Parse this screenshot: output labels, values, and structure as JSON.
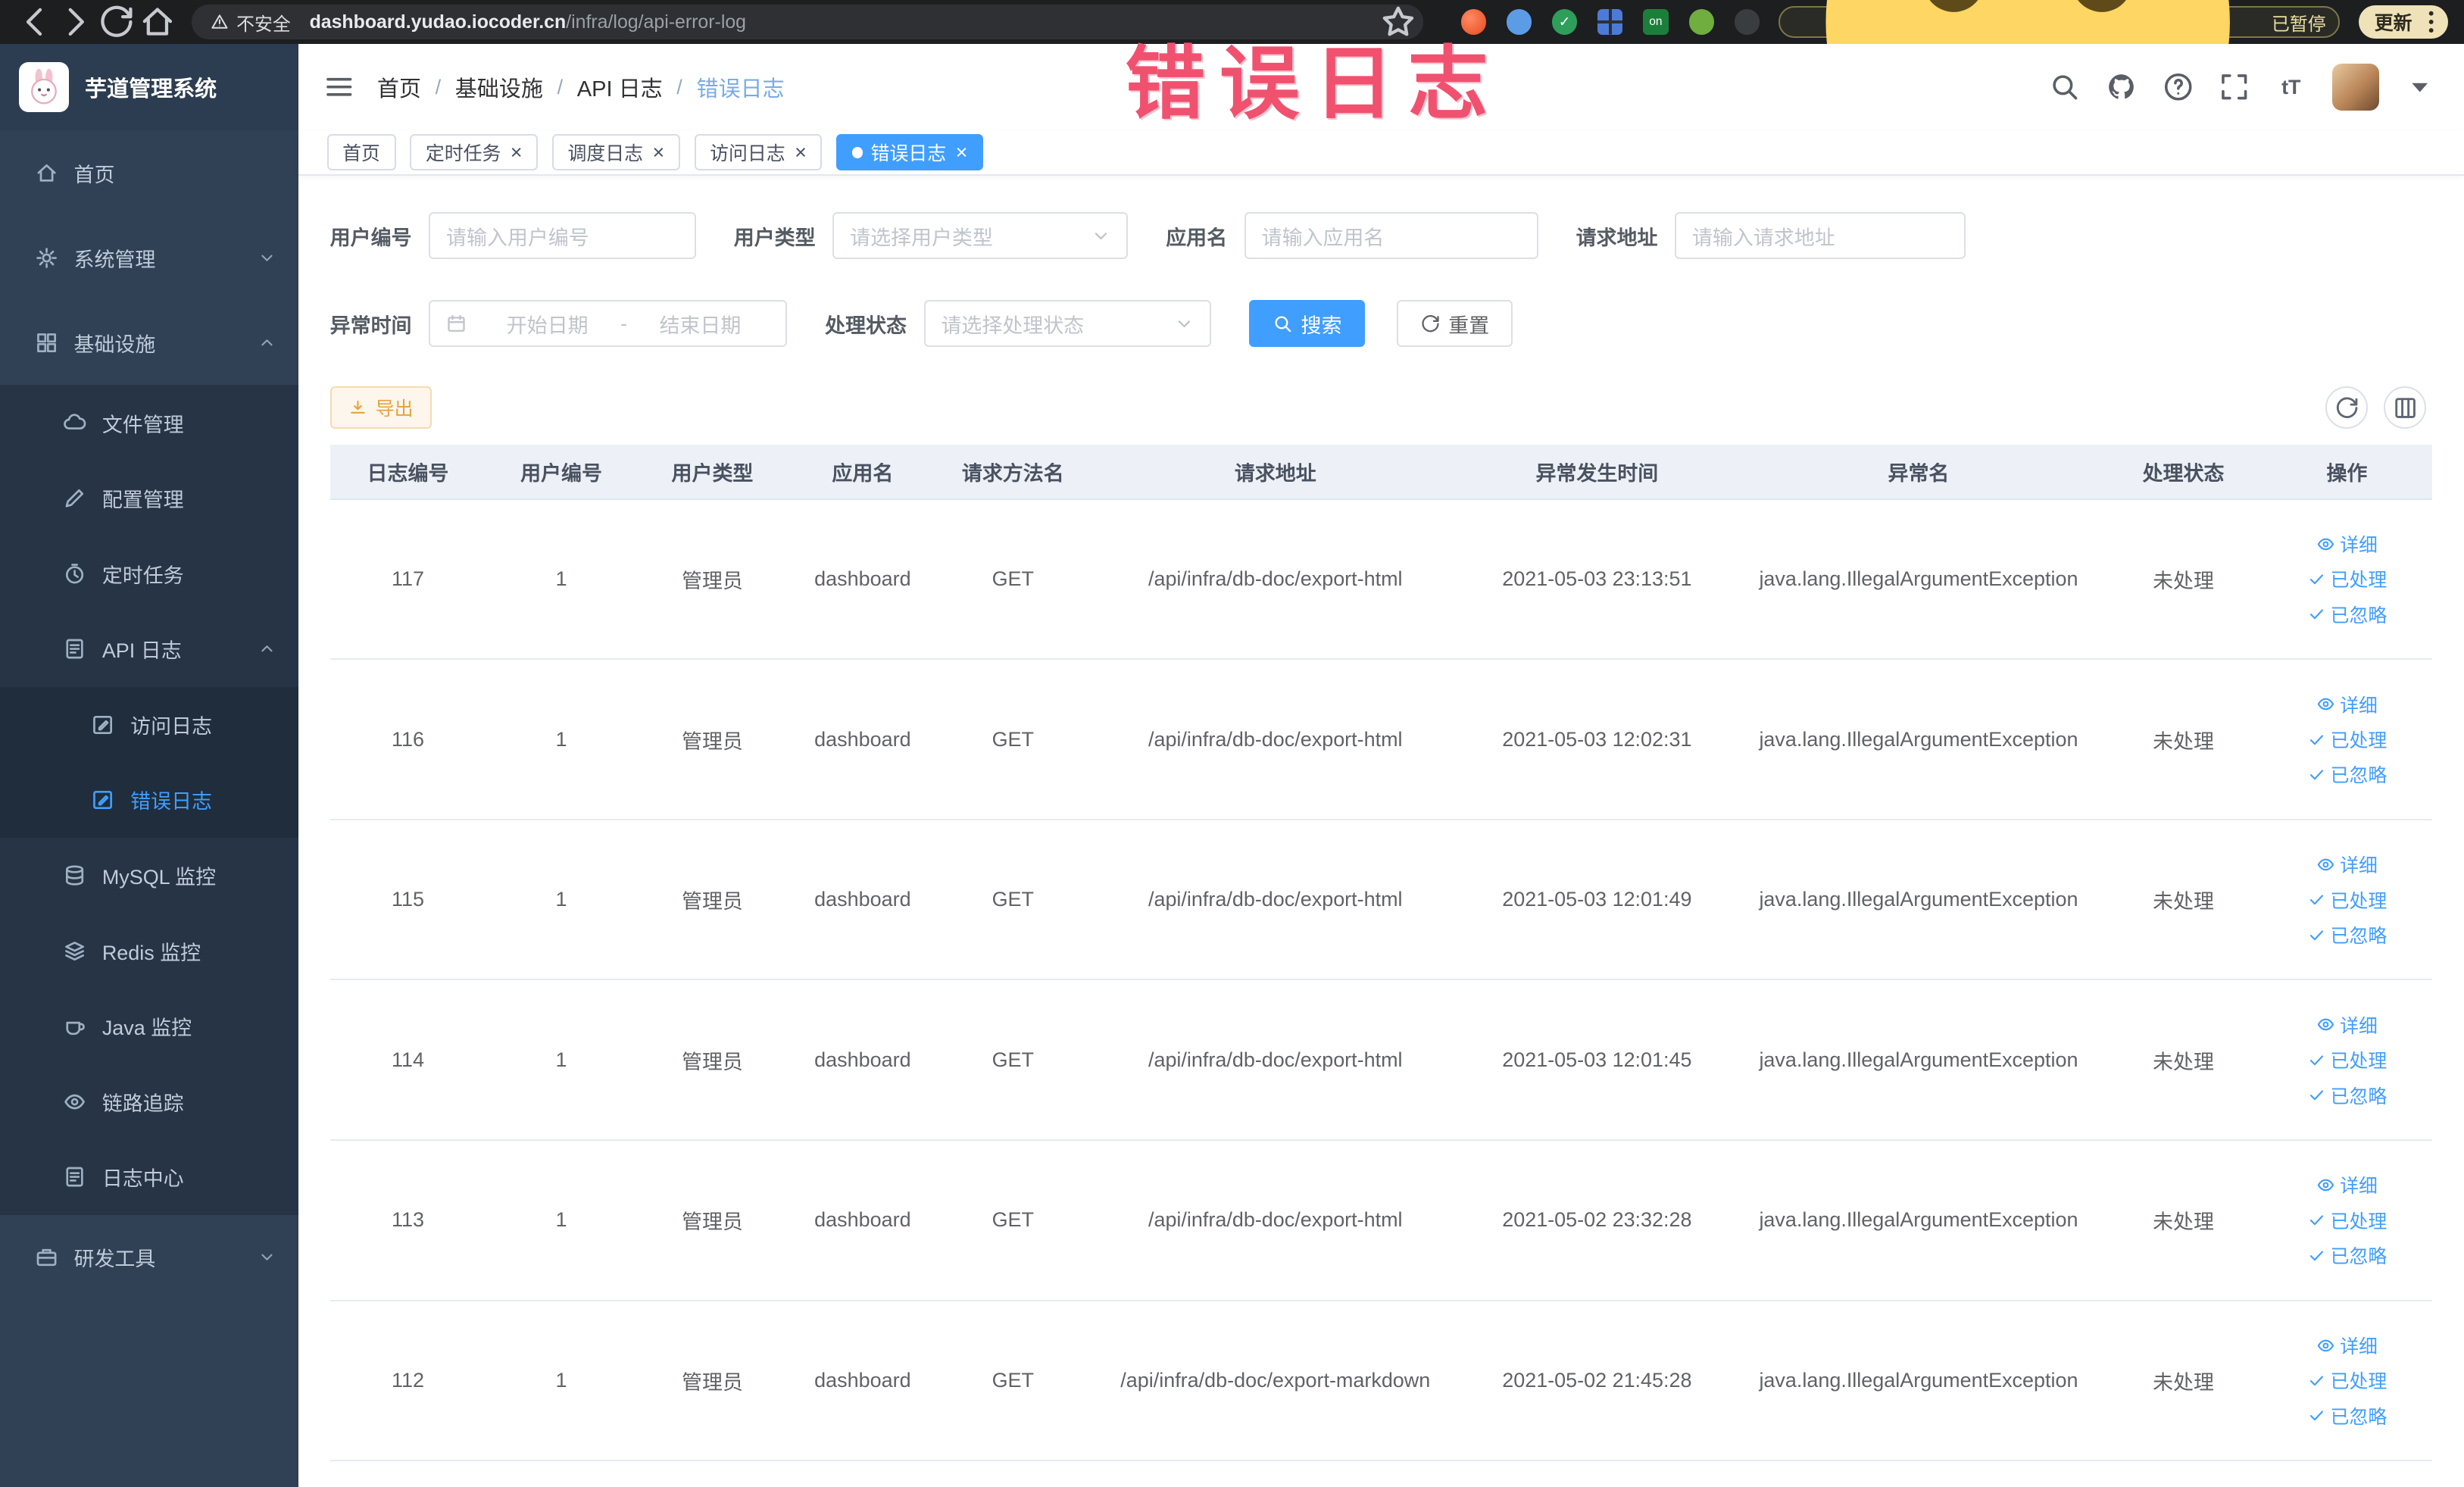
{
  "browser": {
    "security_warning": "不安全",
    "url_domain": "dashboard.yudao.iocoder.cn",
    "url_path": "/infra/log/api-error-log",
    "paused_badge": "已暂停",
    "update_button": "更新"
  },
  "annotation": {
    "text": "错误日志",
    "color": "#f0516f"
  },
  "sidebar": {
    "logo_title": "芋道管理系统",
    "items": [
      {
        "name": "home",
        "label": "首页",
        "icon": "home",
        "level": 1
      },
      {
        "name": "system-management",
        "label": "系统管理",
        "icon": "gear",
        "level": 1,
        "chevron": "down"
      },
      {
        "name": "infrastructure",
        "label": "基础设施",
        "icon": "grid",
        "level": 1,
        "chevron": "up"
      },
      {
        "name": "file-management",
        "label": "文件管理",
        "icon": "cloud",
        "level": 2
      },
      {
        "name": "config-management",
        "label": "配置管理",
        "icon": "pencil",
        "level": 2
      },
      {
        "name": "scheduled-tasks",
        "label": "定时任务",
        "icon": "timer",
        "level": 2
      },
      {
        "name": "api-logs",
        "label": "API 日志",
        "icon": "doc",
        "level": 2,
        "chevron": "up"
      },
      {
        "name": "access-logs",
        "label": "访问日志",
        "icon": "edit-square",
        "level": 3
      },
      {
        "name": "error-logs",
        "label": "错误日志",
        "icon": "edit-square",
        "level": 3,
        "active": true
      },
      {
        "name": "mysql-monitor",
        "label": "MySQL 监控",
        "icon": "database",
        "level": 2
      },
      {
        "name": "redis-monitor",
        "label": "Redis 监控",
        "icon": "layers",
        "level": 2
      },
      {
        "name": "java-monitor",
        "label": "Java 监控",
        "icon": "coffee",
        "level": 2
      },
      {
        "name": "tracing",
        "label": "链路追踪",
        "icon": "eye",
        "level": 2
      },
      {
        "name": "log-center",
        "label": "日志中心",
        "icon": "doc",
        "level": 2
      },
      {
        "name": "dev-tools",
        "label": "研发工具",
        "icon": "briefcase",
        "level": 1,
        "chevron": "down"
      }
    ]
  },
  "breadcrumb": [
    "首页",
    "基础设施",
    "API 日志",
    "错误日志"
  ],
  "tabs": [
    {
      "label": "首页",
      "closable": false,
      "active": false
    },
    {
      "label": "定时任务",
      "closable": true,
      "active": false
    },
    {
      "label": "调度日志",
      "closable": true,
      "active": false
    },
    {
      "label": "访问日志",
      "closable": true,
      "active": false
    },
    {
      "label": "错误日志",
      "closable": true,
      "active": true
    }
  ],
  "filters": {
    "user_id_label": "用户编号",
    "user_id_placeholder": "请输入用户编号",
    "user_type_label": "用户类型",
    "user_type_placeholder": "请选择用户类型",
    "app_name_label": "应用名",
    "app_name_placeholder": "请输入应用名",
    "request_url_label": "请求地址",
    "request_url_placeholder": "请输入请求地址",
    "exception_time_label": "异常时间",
    "date_start_placeholder": "开始日期",
    "date_separator": "-",
    "date_end_placeholder": "结束日期",
    "process_status_label": "处理状态",
    "process_status_placeholder": "请选择处理状态",
    "search_button": "搜索",
    "reset_button": "重置"
  },
  "toolbar": {
    "export_button": "导出"
  },
  "table": {
    "headers": [
      "日志编号",
      "用户编号",
      "用户类型",
      "应用名",
      "请求方法名",
      "请求地址",
      "异常发生时间",
      "异常名",
      "处理状态",
      "操作"
    ],
    "row_actions": [
      "详细",
      "已处理",
      "已忽略"
    ],
    "rows": [
      {
        "log_id": "117",
        "user_id": "1",
        "user_type": "管理员",
        "app_name": "dashboard",
        "method": "GET",
        "url": "/api/infra/db-doc/export-html",
        "time": "2021-05-03 23:13:51",
        "exception": "java.lang.IllegalArgumentException",
        "status": "未处理"
      },
      {
        "log_id": "116",
        "user_id": "1",
        "user_type": "管理员",
        "app_name": "dashboard",
        "method": "GET",
        "url": "/api/infra/db-doc/export-html",
        "time": "2021-05-03 12:02:31",
        "exception": "java.lang.IllegalArgumentException",
        "status": "未处理"
      },
      {
        "log_id": "115",
        "user_id": "1",
        "user_type": "管理员",
        "app_name": "dashboard",
        "method": "GET",
        "url": "/api/infra/db-doc/export-html",
        "time": "2021-05-03 12:01:49",
        "exception": "java.lang.IllegalArgumentException",
        "status": "未处理"
      },
      {
        "log_id": "114",
        "user_id": "1",
        "user_type": "管理员",
        "app_name": "dashboard",
        "method": "GET",
        "url": "/api/infra/db-doc/export-html",
        "time": "2021-05-03 12:01:45",
        "exception": "java.lang.IllegalArgumentException",
        "status": "未处理"
      },
      {
        "log_id": "113",
        "user_id": "1",
        "user_type": "管理员",
        "app_name": "dashboard",
        "method": "GET",
        "url": "/api/infra/db-doc/export-html",
        "time": "2021-05-02 23:32:28",
        "exception": "java.lang.IllegalArgumentException",
        "status": "未处理"
      },
      {
        "log_id": "112",
        "user_id": "1",
        "user_type": "管理员",
        "app_name": "dashboard",
        "method": "GET",
        "url": "/api/infra/db-doc/export-markdown",
        "time": "2021-05-02 21:45:28",
        "exception": "java.lang.IllegalArgumentException",
        "status": "未处理"
      }
    ]
  }
}
